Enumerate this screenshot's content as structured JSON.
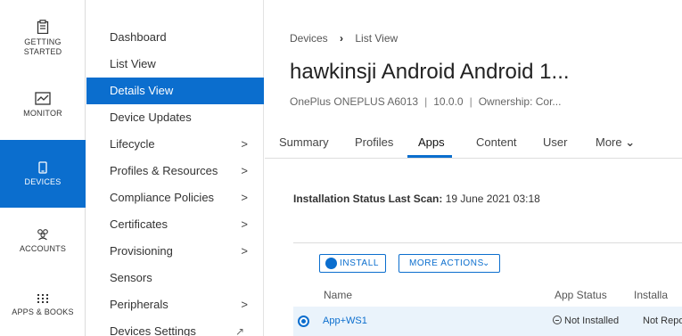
{
  "rail": {
    "items": [
      {
        "label_line1": "GETTING",
        "label_line2": "STARTED",
        "icon": "clipboard-icon"
      },
      {
        "label_line1": "MONITOR",
        "icon": "chart-icon"
      },
      {
        "label_line1": "DEVICES",
        "icon": "device-icon",
        "active": true
      },
      {
        "label_line1": "ACCOUNTS",
        "icon": "people-icon"
      },
      {
        "label_line1": "APPS & BOOKS",
        "icon": "grid-icon"
      }
    ]
  },
  "subnav": {
    "items": [
      {
        "label": "Dashboard"
      },
      {
        "label": "List View"
      },
      {
        "label": "Details View",
        "active": true
      },
      {
        "label": "Device Updates"
      },
      {
        "label": "Lifecycle",
        "chevron": ">"
      },
      {
        "label": "Profiles & Resources",
        "chevron": ">"
      },
      {
        "label": "Compliance Policies",
        "chevron": ">"
      },
      {
        "label": "Certificates",
        "chevron": ">"
      },
      {
        "label": "Provisioning",
        "chevron": ">"
      },
      {
        "label": "Sensors"
      },
      {
        "label": "Peripherals",
        "chevron": ">"
      },
      {
        "label": "Devices Settings",
        "external": "↗"
      }
    ]
  },
  "breadcrumb": {
    "root": "Devices",
    "separator": "›",
    "current": "List View"
  },
  "device": {
    "title": "hawkinsji Android Android 1...",
    "model": "OnePlus ONEPLUS A6013",
    "version": "10.0.0",
    "ownership": "Ownership: Cor..."
  },
  "tabs": [
    {
      "label": "Summary"
    },
    {
      "label": "Profiles"
    },
    {
      "label": "Apps",
      "active": true
    },
    {
      "label": "Content"
    },
    {
      "label": "User"
    },
    {
      "label": "More",
      "caret": "⌄"
    }
  ],
  "status": {
    "label": "Installation Status Last Scan:",
    "value": "19 June 2021 03:18"
  },
  "actions": {
    "install": "INSTALL",
    "more": "MORE ACTIONS",
    "more_caret": "⌄"
  },
  "table": {
    "columns": [
      "Name",
      "App Status",
      "Installa"
    ],
    "rows": [
      {
        "name": "App+WS1",
        "app_status": "Not Installed",
        "install_status": "Not Repo"
      }
    ]
  },
  "colors": {
    "accent": "#0b6ece"
  }
}
